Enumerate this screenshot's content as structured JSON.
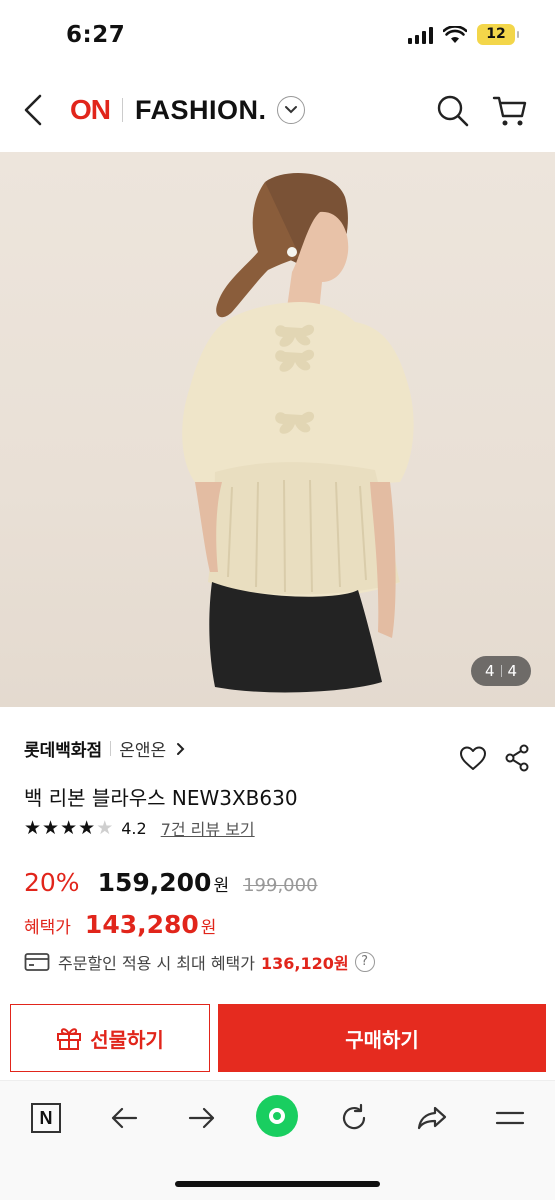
{
  "status": {
    "time": "6:27",
    "battery": "12"
  },
  "header": {
    "logo_on": "ON",
    "logo_fashion": "FASHION."
  },
  "product": {
    "image_counter": {
      "current": "4",
      "total": "4"
    },
    "brand": "롯데백화점",
    "store": "온앤온",
    "title": "백 리본 블라우스 NEW3XB630",
    "rating": {
      "value": "4.2",
      "stars": 4,
      "review_link": "7건 리뷰 보기"
    },
    "price": {
      "discount": "20%",
      "current": "159,200",
      "currency": "원",
      "original": "199,000"
    },
    "benefit": {
      "label": "혜택가",
      "price": "143,280",
      "currency": "원"
    },
    "card_benefit": {
      "text": "주문할인 적용 시 최대 혜택가",
      "amount": "136,120원"
    }
  },
  "actions": {
    "gift_label": "선물하기",
    "buy_label": "구매하기"
  },
  "browser": {
    "n_label": "N"
  },
  "colors": {
    "accent": "#e1251b",
    "naver_green": "#19ce60"
  }
}
